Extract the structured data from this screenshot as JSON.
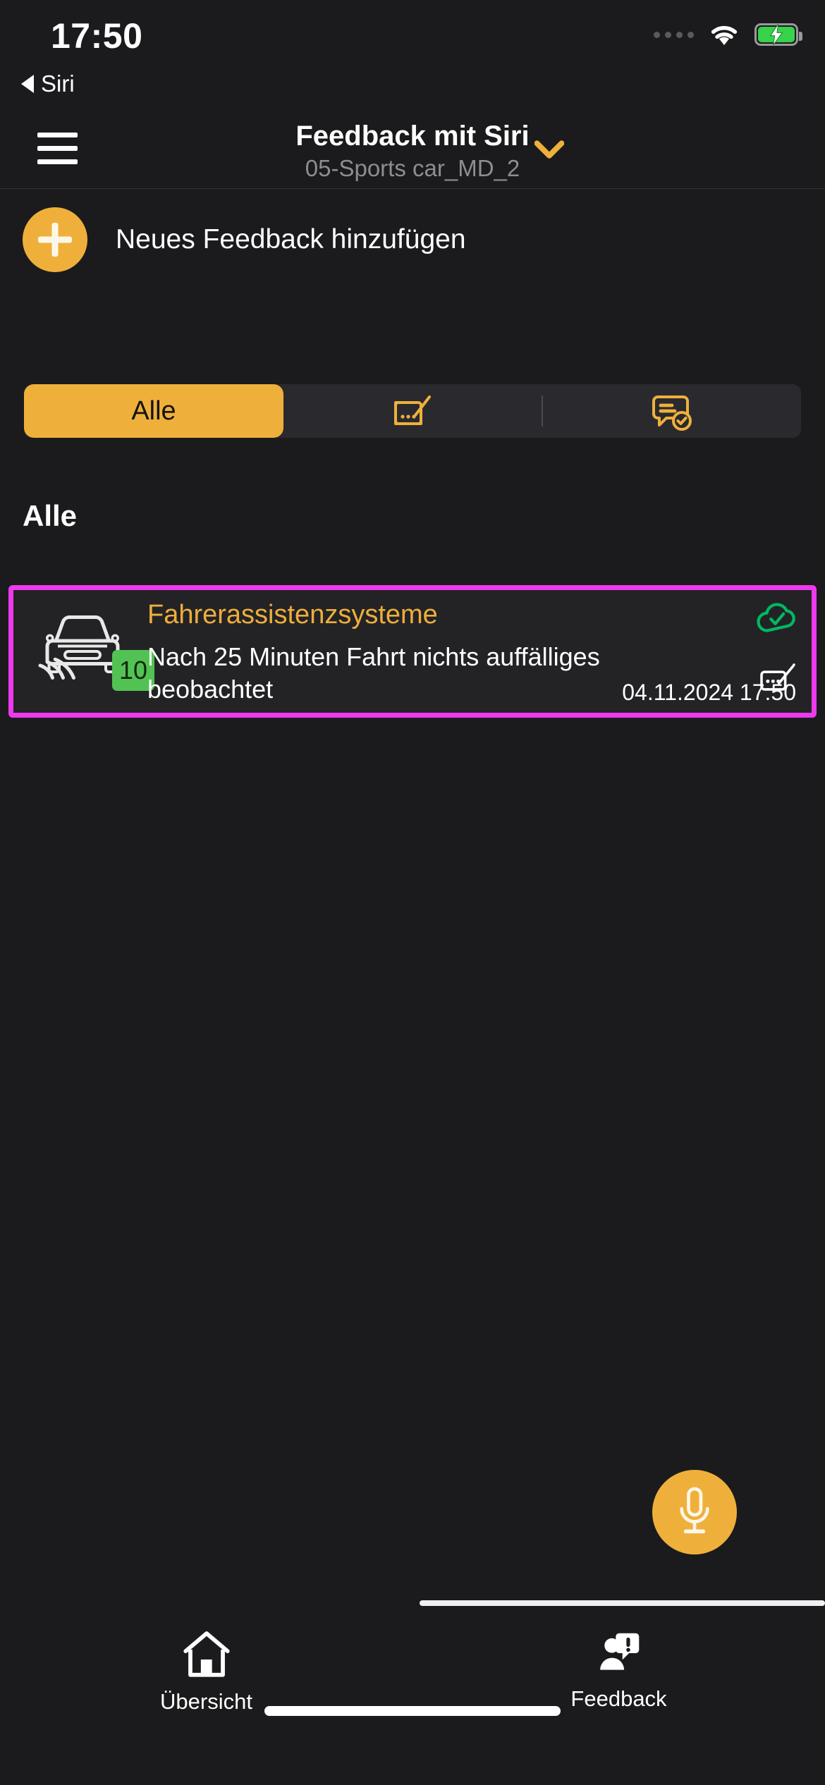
{
  "status_bar": {
    "time": "17:50",
    "signal_icon": "signal-dots-icon",
    "wifi_icon": "wifi-icon",
    "battery_icon": "battery-charging-icon",
    "battery_color": "#37d34a"
  },
  "siri_back": {
    "label": "Siri",
    "icon": "back-triangle-icon"
  },
  "header": {
    "menu_icon": "hamburger-menu-icon",
    "title": "Feedback mit Siri",
    "subtitle": "05-Sports car_MD_2",
    "chevron_icon": "chevron-down-icon",
    "chevron_color": "#efb03b"
  },
  "add_feedback": {
    "label": "Neues Feedback hinzufügen",
    "icon": "plus-icon",
    "color": "#efb03b"
  },
  "segmented_control": {
    "items": [
      {
        "label": "Alle",
        "icon": "",
        "active": true
      },
      {
        "label": "",
        "icon": "note-edit-icon",
        "active": false
      },
      {
        "label": "",
        "icon": "comment-check-icon",
        "active": false
      }
    ],
    "active_bg": "#efb03b",
    "track_bg": "#2a2a2e"
  },
  "section": {
    "title": "Alle"
  },
  "feedback_list": [
    {
      "title": "Fahrerassistenzsysteme",
      "body": "Nach 25 Minuten Fahrt nichts auffälliges beobachtet",
      "date": "04.11.2024 17:50",
      "speed_badge": "10",
      "speed_badge_color": "#53c254",
      "vehicle_icon": "car-front-sensor-icon",
      "sync_icon": "cloud-check-icon",
      "sync_icon_color": "#00b860",
      "edit_icon": "note-edit-icon",
      "highlight_color": "#ee39ee",
      "title_color": "#eeae3c"
    }
  ],
  "voice_button": {
    "icon": "microphone-icon",
    "color": "#efb03b"
  },
  "tab_bar": {
    "items": [
      {
        "label": "Übersicht",
        "icon": "home-icon",
        "active": false
      },
      {
        "label": "Feedback",
        "icon": "person-feedback-icon",
        "active": true
      }
    ]
  }
}
